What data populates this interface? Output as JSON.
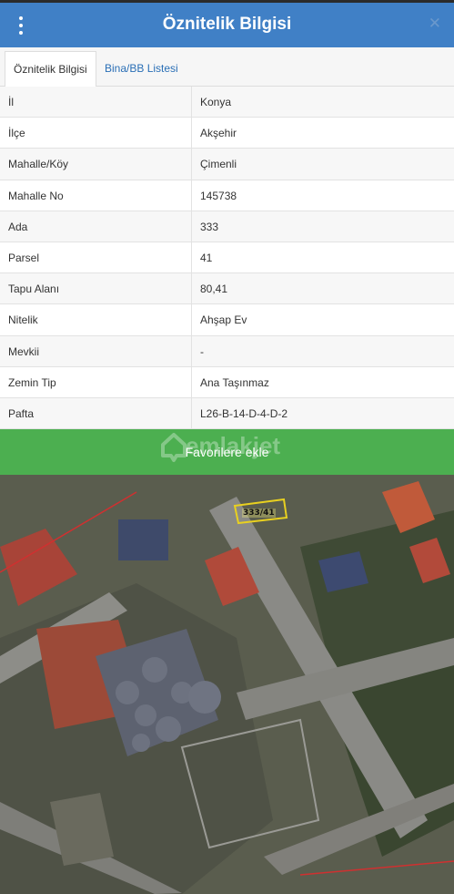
{
  "header": {
    "title": "Öznitelik Bilgisi",
    "close_label": "✕"
  },
  "tabs": [
    {
      "label": "Öznitelik Bilgisi",
      "active": true
    },
    {
      "label": "Bina/BB Listesi",
      "active": false
    }
  ],
  "attributes": [
    {
      "key": "İl",
      "value": "Konya"
    },
    {
      "key": "İlçe",
      "value": "Akşehir"
    },
    {
      "key": "Mahalle/Köy",
      "value": "Çimenli"
    },
    {
      "key": "Mahalle No",
      "value": "145738"
    },
    {
      "key": "Ada",
      "value": "333"
    },
    {
      "key": "Parsel",
      "value": "41"
    },
    {
      "key": "Tapu Alanı",
      "value": "80,41"
    },
    {
      "key": "Nitelik",
      "value": "Ahşap Ev"
    },
    {
      "key": "Mevkii",
      "value": "-"
    },
    {
      "key": "Zemin Tip",
      "value": "Ana Taşınmaz"
    },
    {
      "key": "Pafta",
      "value": "L26-B-14-D-4-D-2"
    }
  ],
  "favorite_button": {
    "label": "Favorilere ekle"
  },
  "watermark": {
    "text": "emlakjet"
  },
  "map": {
    "parcel_label": "333/41"
  },
  "colors": {
    "header": "#4080c6",
    "favorite_button": "#4caf50",
    "tab_link": "#2a6fb6",
    "parcel_outline": "#e8d020",
    "boundary_line": "#d03030"
  }
}
